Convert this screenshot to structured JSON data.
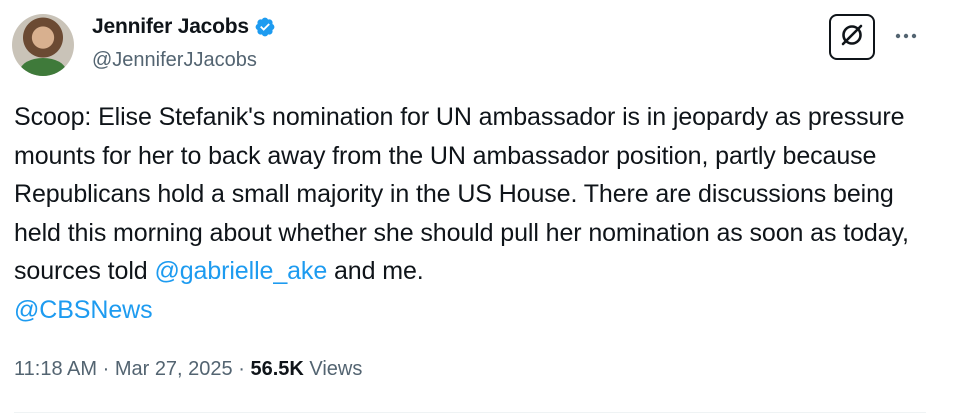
{
  "author": {
    "display_name": "Jennifer Jacobs",
    "handle": "@JenniferJJacobs"
  },
  "tweet": {
    "text_part1": "Scoop: Elise Stefanik's nomination for UN ambassador is in jeopardy as pressure mounts for her to back away from the UN ambassador position, partly because Republicans hold a small majority in the US House. There are discussions being held this morning about whether she should pull her nomination as soon as today, sources told ",
    "mention1": "@gabrielle_ake",
    "text_part2": " and me.",
    "mention2": "@CBSNews"
  },
  "meta": {
    "time": "11:18 AM",
    "separator": " · ",
    "date": "Mar 27, 2025",
    "views_count": "56.5K",
    "views_label": " Views"
  },
  "icons": {
    "verified": "verified-badge-icon",
    "grok": "grok-icon",
    "more": "more-dots-icon"
  },
  "colors": {
    "accent": "#1d9bf0",
    "text": "#0f1419",
    "secondary": "#536471"
  }
}
